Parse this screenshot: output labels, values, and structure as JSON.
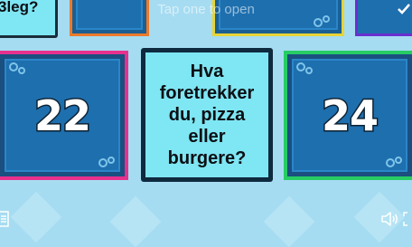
{
  "header": {
    "hint": "Tap one to open"
  },
  "top_left_card": {
    "partial_text": "3leg?"
  },
  "open_card": {
    "question": "Hva foretrekker du, pizza eller burgere?"
  },
  "cards": [
    {
      "number": "22"
    },
    {
      "number": "24"
    }
  ],
  "icons": {
    "check": "checkmark-icon",
    "menu": "menu-icon",
    "volume": "volume-icon",
    "fullscreen": "fullscreen-icon"
  },
  "colors": {
    "background": "#a6dcf1",
    "card_fill": "#1e6fae",
    "card_border_pink": "#e8318c",
    "card_border_green": "#27cc64",
    "card_border_purple": "#6a2fd0",
    "card_border_orange": "#ec7a2a",
    "card_border_yellow": "#e7d436",
    "open_card_fill": "#7fe6f3",
    "open_card_border": "#0e2a3e"
  }
}
